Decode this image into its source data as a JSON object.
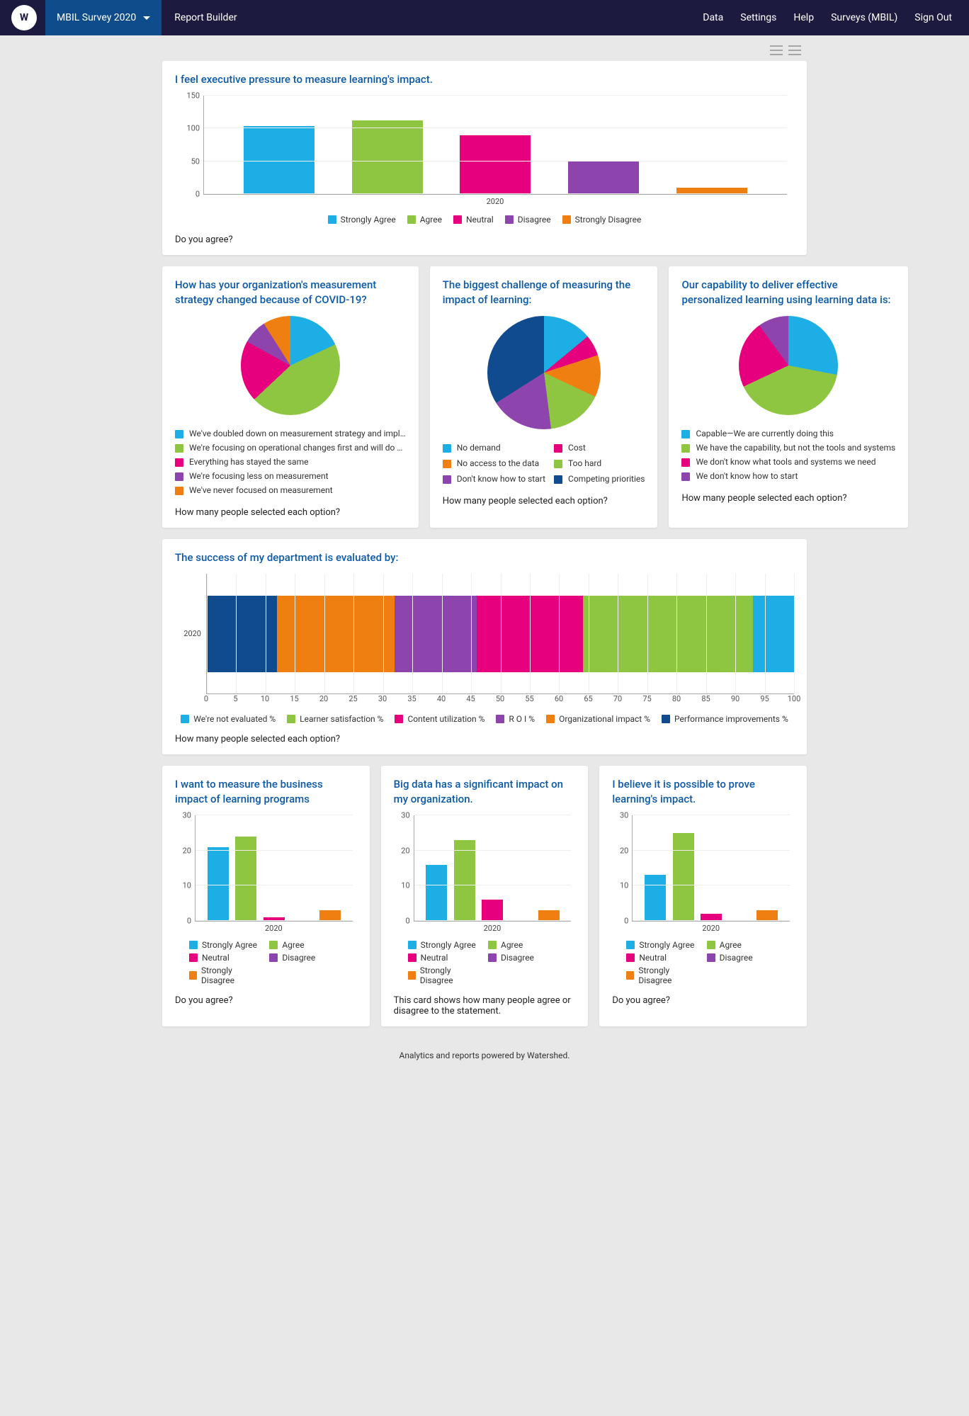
{
  "colors": {
    "blue": "#1daee5",
    "green": "#8ec641",
    "pink": "#e6007e",
    "purple": "#8e44ad",
    "orange": "#f07f12",
    "darkblue": "#104b8f"
  },
  "header": {
    "logo_letter": "W",
    "survey_name": "MBIL Survey 2020",
    "app_name": "Report Builder",
    "nav": [
      "Data",
      "Settings",
      "Help",
      "Surveys (MBIL)",
      "Sign Out"
    ]
  },
  "cards": {
    "c1": {
      "title": "I feel executive pressure to measure learning's impact.",
      "footer": "Do you agree?",
      "xlabel": "2020",
      "legend": [
        "Strongly Agree",
        "Agree",
        "Neutral",
        "Disagree",
        "Strongly Disagree"
      ]
    },
    "c2": {
      "title": "How has your organization's measurement strategy changed because of COVID-19?",
      "footer": "How many people selected each option?",
      "legend": [
        "We've doubled down on measurement strategy and impl…",
        "We're focusing on operational changes first and will do …",
        "Everything has stayed the same",
        "We're focusing less on measurement",
        "We've never focused on measurement"
      ]
    },
    "c3": {
      "title": "The biggest challenge of measuring the impact of learning:",
      "footer": "How many people selected each option?",
      "legend": [
        "No demand",
        "Cost",
        "No access to the data",
        "Too hard",
        "Don't know how to start",
        "Competing priorities"
      ]
    },
    "c4": {
      "title": "Our capability to deliver effective personalized learning using learning data is:",
      "footer": "How many people selected each option?",
      "legend": [
        "Capable—We are currently doing this",
        "We have the capability, but not the tools and systems",
        "We don't know what tools and systems we need",
        "We don't know how to start"
      ]
    },
    "c5": {
      "title": "The success of my department is evaluated by:",
      "footer": "How many people selected each option?",
      "xlabel": "2020",
      "legend": [
        "We're not evaluated %",
        "Learner satisfaction %",
        "Content utilization %",
        "R O I %",
        "Organizational impact %",
        "Performance improvements %"
      ]
    },
    "c6": {
      "title": "I want to measure the business impact of learning programs",
      "footer": "Do you agree?",
      "xlabel": "2020",
      "legend": [
        "Strongly Agree",
        "Agree",
        "Neutral",
        "Disagree",
        "Strongly Disagree"
      ]
    },
    "c7": {
      "title": "Big data has a significant impact on my organization.",
      "footer": "This card shows how many people agree or disagree to the statement.",
      "xlabel": "2020",
      "legend": [
        "Strongly Agree",
        "Agree",
        "Neutral",
        "Disagree",
        "Strongly Disagree"
      ]
    },
    "c8": {
      "title": "I believe it is possible to prove learning's impact.",
      "footer": "Do you agree?",
      "xlabel": "2020",
      "legend": [
        "Strongly Agree",
        "Agree",
        "Neutral",
        "Disagree",
        "Strongly Disagree"
      ]
    }
  },
  "attrib": "Analytics and reports powered by Watershed.",
  "chart_data": [
    {
      "id": "c1",
      "type": "bar",
      "title": "I feel executive pressure to measure learning's impact.",
      "xlabel": "2020",
      "ylabel": "",
      "ylim": [
        0,
        150
      ],
      "yticks": [
        0,
        50,
        100,
        150
      ],
      "categories": [
        "Strongly Agree",
        "Agree",
        "Neutral",
        "Disagree",
        "Strongly Disagree"
      ],
      "values": [
        104,
        112,
        90,
        50,
        10
      ],
      "colors": [
        "blue",
        "green",
        "pink",
        "purple",
        "orange"
      ]
    },
    {
      "id": "c2",
      "type": "pie",
      "title": "How has your organization's measurement strategy changed because of COVID-19?",
      "slices": [
        {
          "label": "We've doubled down on measurement strategy and implementation",
          "value": 18,
          "color": "blue"
        },
        {
          "label": "We're focusing on operational changes first and will do measurement later",
          "value": 45,
          "color": "green"
        },
        {
          "label": "Everything has stayed the same",
          "value": 20,
          "color": "pink"
        },
        {
          "label": "We're focusing less on measurement",
          "value": 8,
          "color": "purple"
        },
        {
          "label": "We've never focused on measurement",
          "value": 9,
          "color": "orange"
        }
      ]
    },
    {
      "id": "c3",
      "type": "pie",
      "title": "The biggest challenge of measuring the impact of learning:",
      "slices": [
        {
          "label": "No demand",
          "value": 14,
          "color": "blue"
        },
        {
          "label": "Cost",
          "value": 6,
          "color": "pink"
        },
        {
          "label": "No access to the data",
          "value": 12,
          "color": "orange"
        },
        {
          "label": "Too hard",
          "value": 16,
          "color": "green"
        },
        {
          "label": "Don't know how to start",
          "value": 18,
          "color": "purple"
        },
        {
          "label": "Competing priorities",
          "value": 34,
          "color": "darkblue"
        }
      ]
    },
    {
      "id": "c4",
      "type": "pie",
      "title": "Our capability to deliver effective personalized learning using learning data is:",
      "slices": [
        {
          "label": "Capable—We are currently doing this",
          "value": 28,
          "color": "blue"
        },
        {
          "label": "We have the capability, but not the tools and systems",
          "value": 40,
          "color": "green"
        },
        {
          "label": "We don't know what tools and systems we need",
          "value": 22,
          "color": "pink"
        },
        {
          "label": "We don't know how to start",
          "value": 10,
          "color": "purple"
        }
      ]
    },
    {
      "id": "c5",
      "type": "bar",
      "orientation": "stacked-horizontal",
      "title": "The success of my department is evaluated by:",
      "ylabel_cat": "2020",
      "xlim": [
        0,
        100
      ],
      "xticks": [
        0,
        5,
        10,
        15,
        20,
        25,
        30,
        35,
        40,
        45,
        50,
        55,
        60,
        65,
        70,
        75,
        80,
        85,
        90,
        95,
        100
      ],
      "segments": [
        {
          "label": "Performance improvements %",
          "value": 12,
          "color": "darkblue"
        },
        {
          "label": "Organizational impact %",
          "value": 20,
          "color": "orange"
        },
        {
          "label": "R O I %",
          "value": 14,
          "color": "purple"
        },
        {
          "label": "Content utilization %",
          "value": 18,
          "color": "pink"
        },
        {
          "label": "Learner satisfaction %",
          "value": 29,
          "color": "green"
        },
        {
          "label": "We're not evaluated %",
          "value": 7,
          "color": "blue"
        }
      ]
    },
    {
      "id": "c6",
      "type": "bar",
      "title": "I want to measure the business impact of learning programs",
      "xlabel": "2020",
      "ylim": [
        0,
        30
      ],
      "yticks": [
        0,
        10,
        20,
        30
      ],
      "categories": [
        "Strongly Agree",
        "Agree",
        "Neutral",
        "Disagree",
        "Strongly Disagree"
      ],
      "values": [
        21,
        24,
        1,
        0,
        3
      ],
      "colors": [
        "blue",
        "green",
        "pink",
        "purple",
        "orange"
      ]
    },
    {
      "id": "c7",
      "type": "bar",
      "title": "Big data has a significant impact on my organization.",
      "xlabel": "2020",
      "ylim": [
        0,
        30
      ],
      "yticks": [
        0,
        10,
        20,
        30
      ],
      "categories": [
        "Strongly Agree",
        "Agree",
        "Neutral",
        "Disagree",
        "Strongly Disagree"
      ],
      "values": [
        16,
        23,
        6,
        0,
        3
      ],
      "colors": [
        "blue",
        "green",
        "pink",
        "purple",
        "orange"
      ]
    },
    {
      "id": "c8",
      "type": "bar",
      "title": "I believe it is possible to prove learning's impact.",
      "xlabel": "2020",
      "ylim": [
        0,
        30
      ],
      "yticks": [
        0,
        10,
        20,
        30
      ],
      "categories": [
        "Strongly Agree",
        "Agree",
        "Neutral",
        "Disagree",
        "Strongly Disagree"
      ],
      "values": [
        13,
        25,
        2,
        0,
        3
      ],
      "colors": [
        "blue",
        "green",
        "pink",
        "purple",
        "orange"
      ]
    }
  ]
}
